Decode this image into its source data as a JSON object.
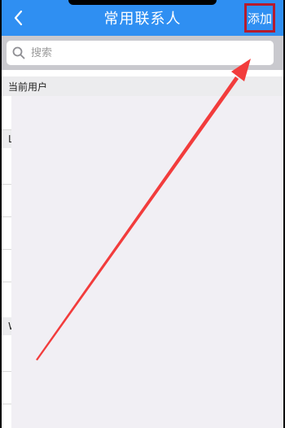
{
  "header": {
    "title": "常用联系人",
    "add_label": "添加",
    "back_icon": "chevron-left-icon"
  },
  "search": {
    "placeholder": "搜索",
    "value": ""
  },
  "sections": {
    "current_user_label": "当前用户",
    "section_l_label": "L",
    "section_w_label": "W"
  },
  "colors": {
    "header_bg": "#2f8ff2",
    "highlight_border": "#b61b2d",
    "annotation_arrow": "#f23c3c"
  }
}
